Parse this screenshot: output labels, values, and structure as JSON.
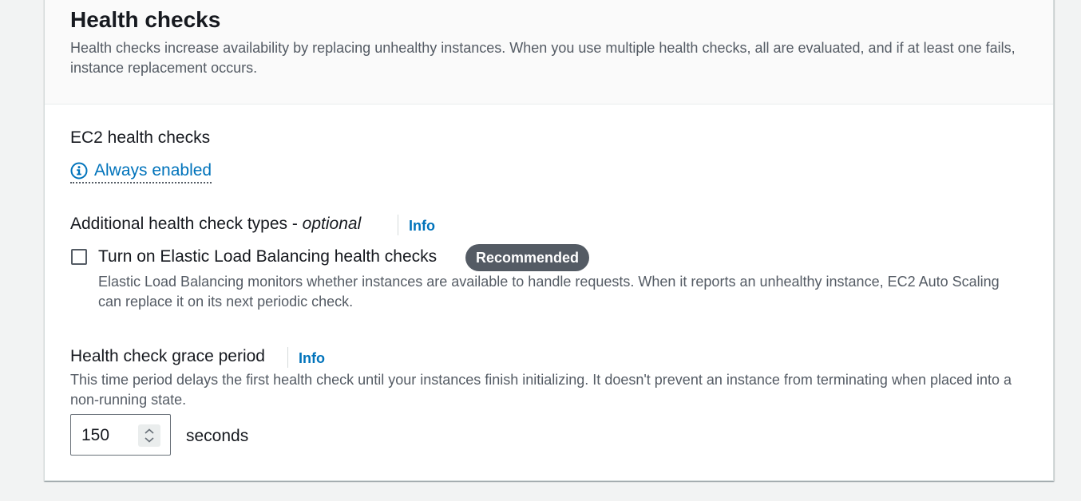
{
  "section": {
    "title": "Health checks",
    "description": "Health checks increase availability by replacing unhealthy instances. When you use multiple health checks, all are evaluated, and if at least one fails, instance replacement occurs."
  },
  "ec2": {
    "label": "EC2 health checks",
    "status": "Always enabled",
    "status_icon": "info-circle-icon"
  },
  "additional": {
    "label": "Additional health check types - ",
    "label_optional": "optional",
    "info": "Info",
    "elb_checkbox": {
      "label": "Turn on Elastic Load Balancing health checks",
      "checked": false,
      "badge": "Recommended",
      "description": "Elastic Load Balancing monitors whether instances are available to handle requests. When it reports an unhealthy instance, EC2 Auto Scaling can replace it on its next periodic check."
    }
  },
  "grace_period": {
    "label": "Health check grace period",
    "info": "Info",
    "description": "This time period delays the first health check until your instances finish initializing. It doesn't prevent an instance from terminating when placed into a non-running state.",
    "value": "150",
    "unit": "seconds"
  },
  "colors": {
    "link": "#0073bb",
    "badge_bg": "#545b64",
    "text": "#16191f",
    "secondary_text": "#545b64"
  }
}
